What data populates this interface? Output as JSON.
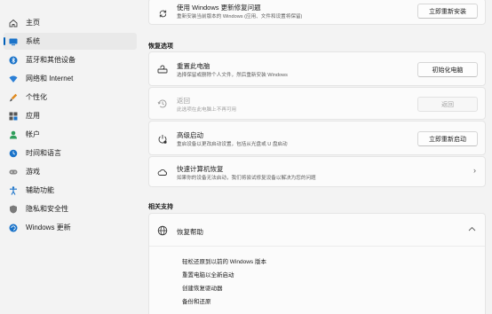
{
  "sidebar": {
    "items": [
      {
        "label": "主页",
        "icon": "home-icon"
      },
      {
        "label": "系统",
        "icon": "system-icon",
        "active": true
      },
      {
        "label": "蓝牙和其他设备",
        "icon": "bluetooth-icon"
      },
      {
        "label": "网络和 Internet",
        "icon": "network-icon"
      },
      {
        "label": "个性化",
        "icon": "personalization-icon"
      },
      {
        "label": "应用",
        "icon": "apps-icon"
      },
      {
        "label": "帐户",
        "icon": "account-icon"
      },
      {
        "label": "时间和语言",
        "icon": "time-language-icon"
      },
      {
        "label": "游戏",
        "icon": "gaming-icon"
      },
      {
        "label": "辅助功能",
        "icon": "accessibility-icon"
      },
      {
        "label": "隐私和安全性",
        "icon": "privacy-icon"
      },
      {
        "label": "Windows 更新",
        "icon": "windows-update-icon"
      }
    ]
  },
  "top_card": {
    "title": "使用 Windows 更新修复问题",
    "desc": "重新安装当前版本的 Windows (应用、文件和设置将保留)",
    "button": "立即重新安装"
  },
  "recovery": {
    "section_title": "恢复选项",
    "reset": {
      "title": "重置此电脑",
      "desc": "选择保留或删除个人文件，然后重新安装 Windows",
      "button": "初始化电脑"
    },
    "goback": {
      "title": "返回",
      "desc": "此选项在此电脑上不再可用",
      "button": "返回"
    },
    "advanced": {
      "title": "高级启动",
      "desc": "重启设备以更改启动设置，包括从光盘或 U 盘启动",
      "button": "立即重新启动"
    },
    "quick": {
      "title": "快速计算机恢复",
      "desc": "如果你的设备无法启动，我们将尝试修复设备以解决为您的问题"
    }
  },
  "related": {
    "section_title": "相关支持",
    "help_title": "恢复帮助",
    "links": [
      "轻松还原到以前的 Windows 版本",
      "重置电脑以全新启动",
      "创建恢复驱动器",
      "备份和还原"
    ]
  },
  "colors": {
    "accent": "#005fb8",
    "background": "#f3f3f3",
    "card": "#fbfbfb"
  }
}
